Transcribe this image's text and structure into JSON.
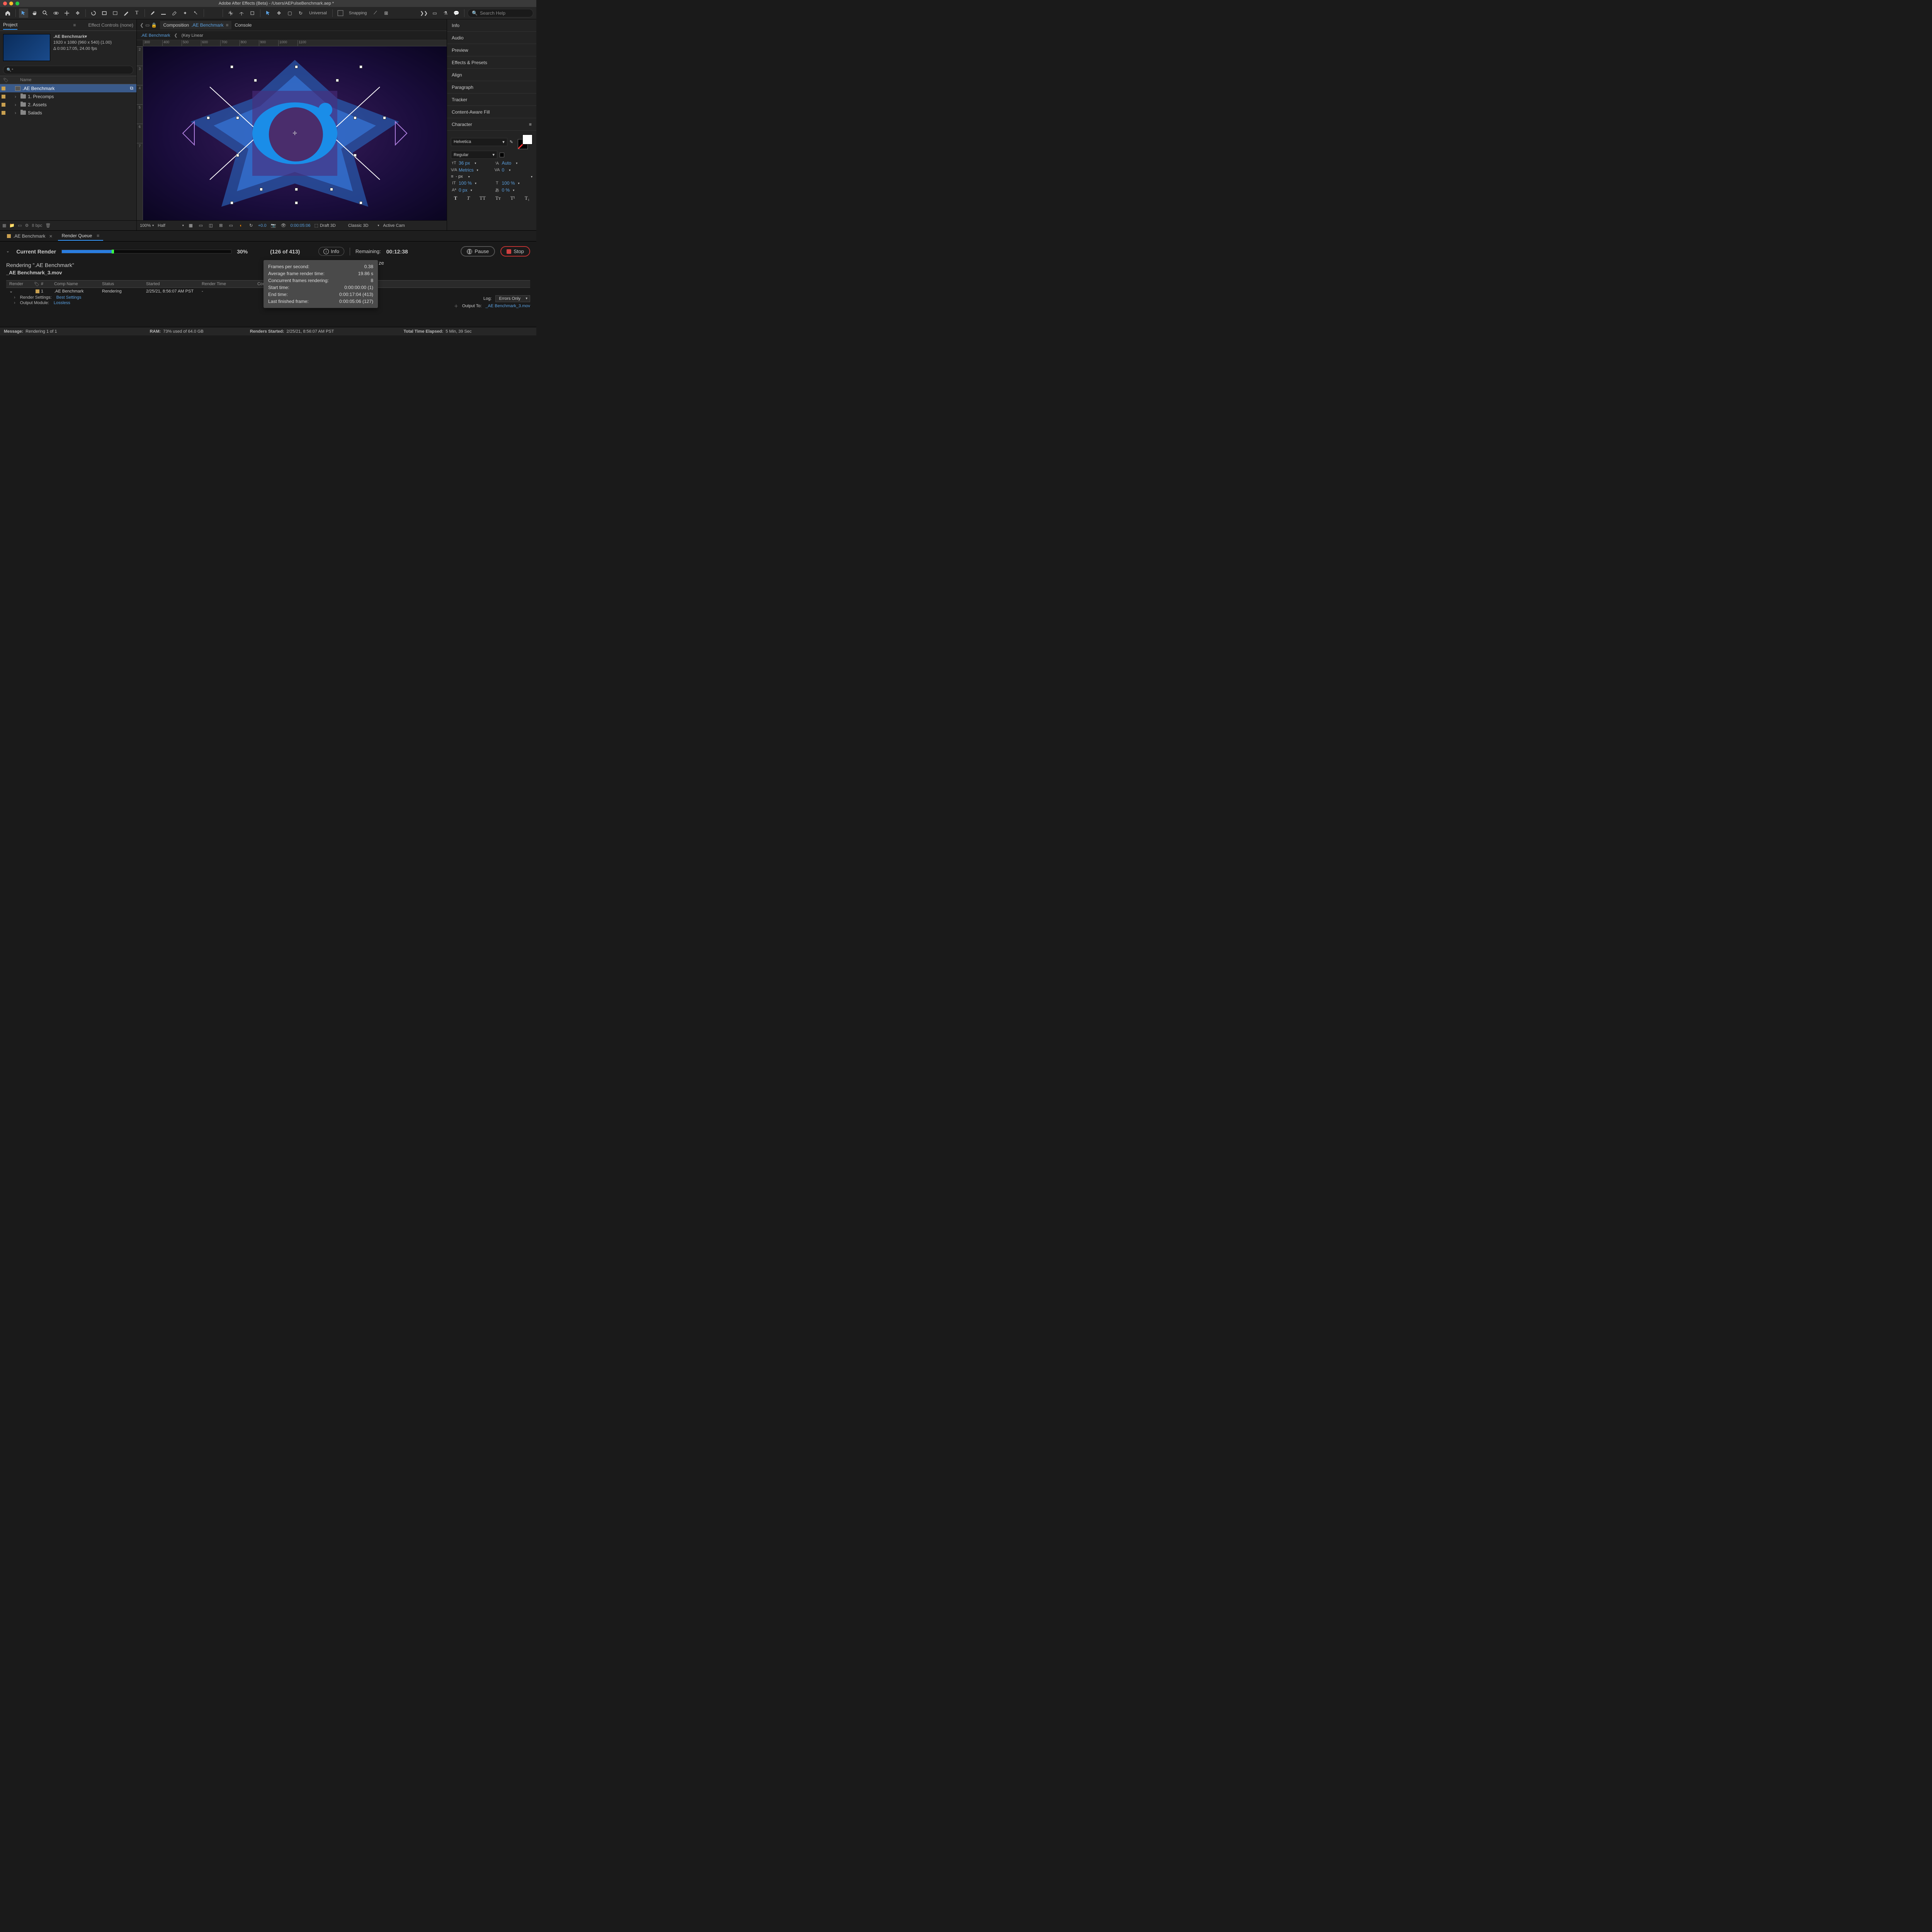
{
  "window": {
    "title": "Adobe After Effects (Beta) - /Users/AEPulseBenchmark.aep *"
  },
  "toolbar": {
    "axis_label": "Universal",
    "snapping": "Snapping",
    "search_placeholder": "Search Help"
  },
  "project_panel": {
    "tab_project": "Project",
    "tab_effect_controls": "Effect Controls (none)",
    "comp_name": ".AE Benchmark▾",
    "comp_res": "1920 x 1080  (960 x 540) (1.00)",
    "comp_dur": "Δ 0:00:17:05, 24.00 fps",
    "col_name": "Name",
    "items": [
      {
        "name": ".AE Benchmark",
        "selected": true,
        "type": "comp"
      },
      {
        "name": "1. Precomps",
        "type": "folder"
      },
      {
        "name": "2. Assets",
        "type": "folder"
      },
      {
        "name": "Salads",
        "type": "folder"
      }
    ],
    "bpc": "8 bpc"
  },
  "composition": {
    "tab_label": "Composition",
    "comp_name": ".AE Benchmark",
    "tab_console": "Console",
    "breadcrumb_comp": ".AE Benchmark",
    "breadcrumb_extra": "(Key Linear",
    "ruler_h": [
      "300",
      "400",
      "500",
      "600",
      "700",
      "800",
      "900",
      "1000",
      "1100"
    ],
    "ruler_v": [
      "2",
      "3",
      "4",
      "5",
      "6",
      "7"
    ]
  },
  "viewer_footer": {
    "zoom": "100%",
    "quality": "Half",
    "exposure": "+0.0",
    "timecode": "0:00:05:06",
    "draft3d": "Draft 3D",
    "renderer": "Classic 3D",
    "camera": "Active Cam"
  },
  "right_panels": {
    "items": [
      "Info",
      "Audio",
      "Preview",
      "Effects & Presets",
      "Align",
      "Paragraph",
      "Tracker",
      "Content-Aware Fill"
    ],
    "character": {
      "title": "Character",
      "font": "Helvetica",
      "style": "Regular",
      "size": "36 px",
      "leading": "Auto",
      "kerning": "Metrics",
      "tracking": "0",
      "stroke": "- px",
      "vscale": "100 %",
      "hscale": "100 %",
      "baseline": "0 px",
      "tsume": "0 %"
    }
  },
  "timeline": {
    "tab_comp": ".AE Benchmark",
    "tab_rq": "Render Queue",
    "current_render_label": "Current Render",
    "percent": "30%",
    "frames": "(126 of 413)",
    "info_btn": "Info",
    "remaining_label": "Remaining:",
    "remaining_time": "00:12:38",
    "pause": "Pause",
    "stop": "Stop",
    "rendering_line": "Rendering \".AE Benchmark\"",
    "output_file": "_AE Benchmark_3.mov",
    "headers": {
      "render": "Render",
      "num": "#",
      "comp": "Comp Name",
      "status": "Status",
      "started": "Started",
      "rtime": "Render Time",
      "comment": "Commen"
    },
    "row": {
      "num": "1",
      "comp": ".AE Benchmark",
      "status": "Rendering",
      "started": "2/25/21, 8:56:07 AM PST",
      "rtime": "-"
    },
    "render_settings_label": "Render Settings:",
    "render_settings_value": "Best Settings",
    "output_module_label": "Output Module:",
    "output_module_value": "Lossless",
    "log_label": "Log:",
    "log_value": "Errors Only",
    "output_to_label": "Output To:",
    "output_to_value": "_AE Benchmark_3.mov",
    "ze_fragment": "ze"
  },
  "info_tooltip": {
    "rows": [
      [
        "Frames per second:",
        "0.38"
      ],
      [
        "Average frame render time:",
        "19.86 s"
      ],
      [
        "Concurrent frames rendering:",
        "8"
      ],
      [
        "Start time:",
        "0:00:00:00 (1)"
      ],
      [
        "End time:",
        "0:00:17:04 (413)"
      ],
      [
        "Last finished frame:",
        "0:00:05:06 (127)"
      ]
    ]
  },
  "footer": {
    "message_label": "Message:",
    "message": "Rendering 1 of 1",
    "ram_label": "RAM:",
    "ram": "73% used of 64.0 GB",
    "renders_started_label": "Renders Started:",
    "renders_started": "2/25/21, 8:56:07 AM PST",
    "elapsed_label": "Total Time Elapsed:",
    "elapsed": "5 Min, 39 Sec"
  }
}
